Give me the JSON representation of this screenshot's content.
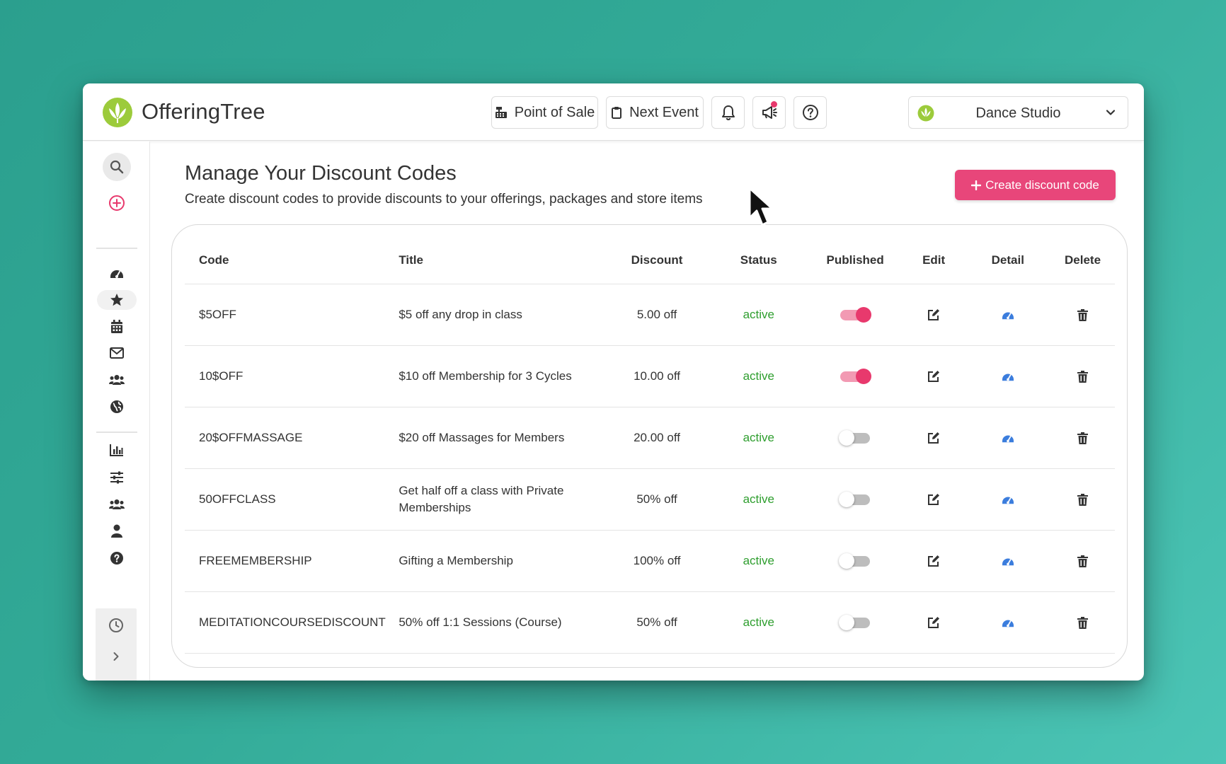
{
  "header": {
    "brand": "OfferingTree",
    "point_of_sale": "Point of Sale",
    "next_event": "Next Event",
    "studio": "Dance Studio"
  },
  "page": {
    "title": "Manage Your Discount Codes",
    "subtitle": "Create discount codes to provide discounts to your offerings, packages and store items",
    "create_button": "Create discount code"
  },
  "table": {
    "columns": [
      "Code",
      "Title",
      "Discount",
      "Status",
      "Published",
      "Edit",
      "Detail",
      "Delete"
    ],
    "rows": [
      {
        "code": "$5OFF",
        "title": "$5 off any drop in class",
        "discount": "5.00 off",
        "status": "active",
        "published": true
      },
      {
        "code": "10$OFF",
        "title": "$10 off Membership for 3 Cycles",
        "discount": "10.00 off",
        "status": "active",
        "published": true
      },
      {
        "code": "20$OFFMASSAGE",
        "title": "$20 off Massages for Members",
        "discount": "20.00 off",
        "status": "active",
        "published": false
      },
      {
        "code": "50OFFCLASS",
        "title": "Get half off a class with Private Memberships",
        "discount": "50% off",
        "status": "active",
        "published": false
      },
      {
        "code": "FREEMEMBERSHIP",
        "title": "Gifting a Membership",
        "discount": "100% off",
        "status": "active",
        "published": false
      },
      {
        "code": "MEDITATIONCOURSEDISCOUNT",
        "title": "50% off 1:1 Sessions (Course)",
        "discount": "50% off",
        "status": "active",
        "published": false
      }
    ]
  },
  "colors": {
    "accent": "#e8467a",
    "toggle_on": "#e8396d",
    "status_active": "#2e9e2e",
    "detail_icon": "#3b7ddd"
  },
  "icons": {
    "search": "search-icon",
    "add": "plus-circle-icon",
    "dashboard": "gauge-icon",
    "offerings": "star-icon",
    "calendar": "calendar-icon",
    "messages": "envelope-icon",
    "customers": "users-icon",
    "website": "globe-icon",
    "reports": "bar-chart-icon",
    "settings": "sliders-icon",
    "staff": "users-icon",
    "account": "user-icon",
    "help": "question-circle-icon",
    "history": "clock-icon",
    "expand": "chevron-right-icon"
  }
}
